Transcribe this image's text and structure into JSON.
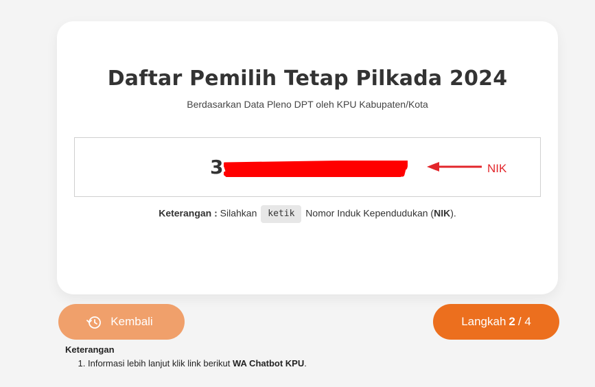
{
  "header": {
    "title": "Daftar Pemilih Tetap Pilkada 2024",
    "subtitle": "Berdasarkan Data Pleno DPT oleh KPU Kabupaten/Kota"
  },
  "nik_field": {
    "value": "3",
    "annotation_label": "NIK",
    "annotation_color": "#e2262b"
  },
  "hint": {
    "label": "Keterangan :",
    "text_before": "Silahkan",
    "key": "ketik",
    "text_after": "Nomor Induk Kependudukan (",
    "nik": "NIK",
    "text_end": ")."
  },
  "buttons": {
    "back_label": "Kembali",
    "back_icon": "history-clock-icon",
    "step_prefix": "Langkah",
    "step_current": "2",
    "step_separator": "/ 4"
  },
  "notes": {
    "title": "Keterangan",
    "items": [
      {
        "text": "Informasi lebih lanjut klik link berikut ",
        "bold": "WA Chatbot KPU",
        "end": "."
      }
    ]
  },
  "colors": {
    "back_button": "#f0a06b",
    "step_button": "#ec6f1e",
    "redaction": "#ff0000"
  }
}
